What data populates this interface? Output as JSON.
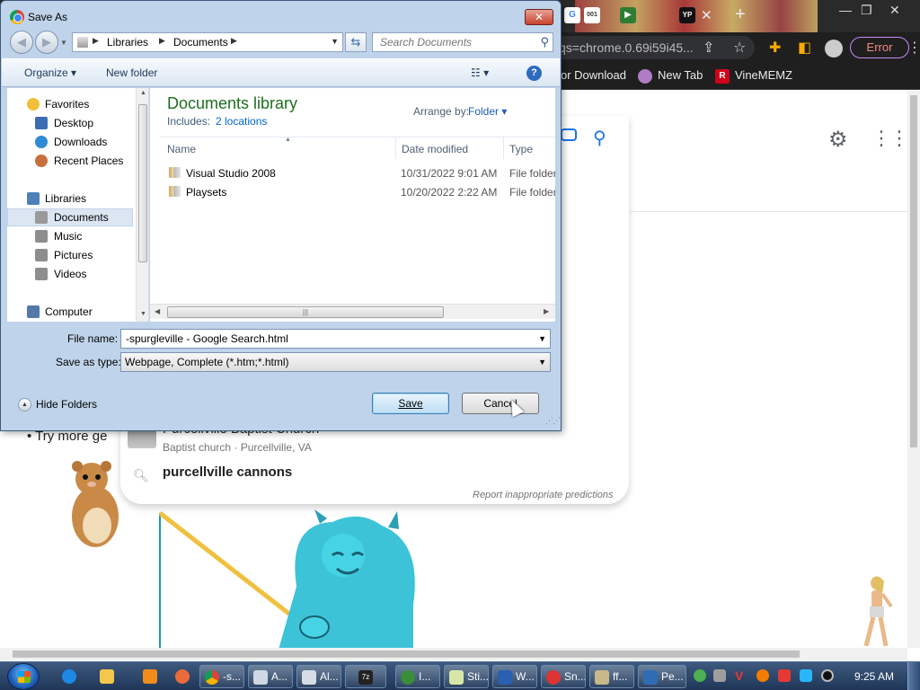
{
  "chrome": {
    "url": "qs=chrome.0.69i59i45...",
    "error_chip": "Error",
    "tab_icons": [
      "G",
      "001",
      "YP"
    ],
    "bookmarks": [
      {
        "label": "or Download"
      },
      {
        "label": "New Tab"
      },
      {
        "label": "VineMEMZ",
        "icon_letter": "R"
      }
    ]
  },
  "page": {
    "try_more_label": "Try more ge",
    "suggestion_place_title": "Purcellville Baptist Church",
    "suggestion_place_sub": "Baptist church · Purcellville, VA",
    "suggestion_query": "purcellville cannons",
    "report_label": "Report inappropriate predictions"
  },
  "dialog": {
    "title": "Save As",
    "close_glyph": "✕",
    "breadcrumbs": [
      "Libraries",
      "Documents"
    ],
    "search_placeholder": "Search Documents",
    "toolbar": {
      "organize_label": "Organize ▾",
      "new_folder_label": "New folder",
      "views_glyph": "☷ ▾",
      "help_glyph": "?"
    },
    "nav": {
      "favorites_header": "Favorites",
      "favorites": [
        "Desktop",
        "Downloads",
        "Recent Places"
      ],
      "libraries_header": "Libraries",
      "libraries": [
        "Documents",
        "Music",
        "Pictures",
        "Videos"
      ],
      "computer_header": "Computer"
    },
    "library": {
      "title": "Documents library",
      "includes_label": "Includes:",
      "includes_link": "2 locations",
      "arrange_label": "Arrange by:",
      "arrange_value": "Folder ▾"
    },
    "columns": [
      "Name",
      "Date modified",
      "Type"
    ],
    "files": [
      {
        "name": "Visual Studio 2008",
        "date": "10/31/2022 9:01 AM",
        "type": "File folder"
      },
      {
        "name": "Playsets",
        "date": "10/20/2022 2:22 AM",
        "type": "File folder"
      }
    ],
    "file_name_label": "File name:",
    "file_name_value": "-spurgleville - Google Search.html",
    "save_type_label": "Save as type:",
    "save_type_value": "Webpage, Complete (*.htm;*.html)",
    "hide_folders_label": "Hide Folders",
    "save_label": "Save",
    "cancel_label": "Cancel"
  },
  "taskbar": {
    "tasks": [
      "-s...",
      "A...",
      "Al...",
      "I...",
      "Sti...",
      "W...",
      "Sn...",
      "ff...",
      "Pe..."
    ],
    "clock": "9:25 AM"
  },
  "colors": {
    "dialog_frame": "#bfd3ea",
    "library_title": "#1e6e1e",
    "link": "#0066cc",
    "chrome_dark": "#1f1f1f"
  }
}
